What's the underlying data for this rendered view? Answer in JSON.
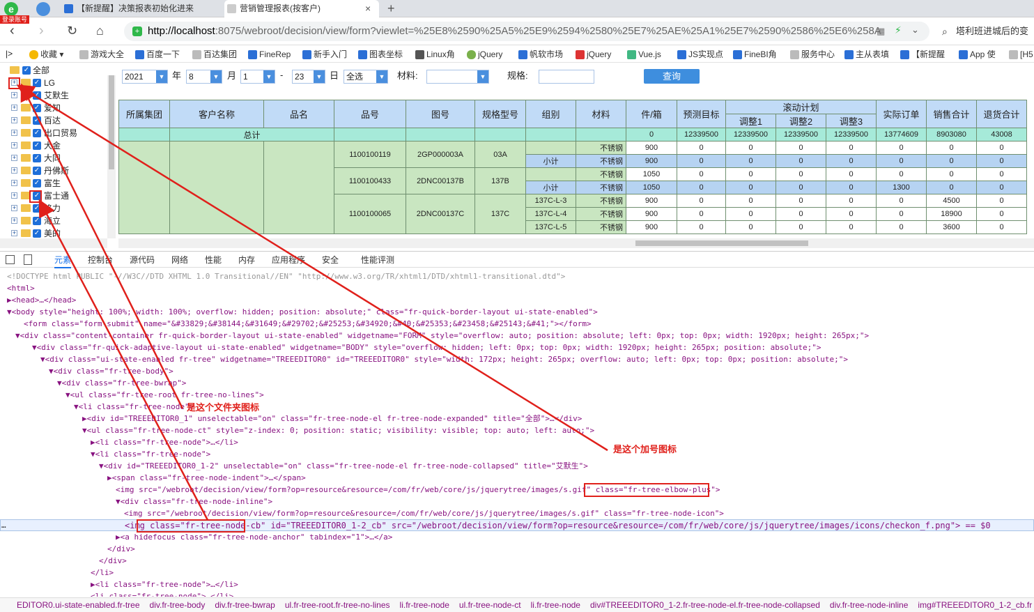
{
  "browser": {
    "tabs": [
      {
        "label": "【新提醒】决策报表初始化进来"
      },
      {
        "label": "营销管理报表(按客户)"
      }
    ],
    "new_tab": "+",
    "close": "×",
    "badge": "登录账号",
    "url_host": "http://localhost",
    "url_rest": ":8075/webroot/decision/view/form?viewlet=%25E8%2590%25A5%25E9%2594%2580%25E7%25AE%25A1%25E7%2590%2586%25E6%258A",
    "search": "塔利班进城后的变",
    "bookmarks": [
      "收藏",
      "游戏大全",
      "百度一下",
      "百达集团",
      "FineRep",
      "新手入门",
      "图表坐标",
      "Linux角",
      "jQuery",
      "帆软市场",
      "jQuery",
      "Vue.js",
      "JS实现点",
      "FineBI角",
      "服务中心",
      "主从表填",
      "【新提醒",
      "App 使",
      "[H5"
    ]
  },
  "tree": {
    "nodes": [
      "全部",
      "LG",
      "艾默生",
      "爱知",
      "百达",
      "出口贸易",
      "大金",
      "大同",
      "丹佛斯",
      "富生",
      "富士通",
      "格力",
      "海立",
      "美的"
    ]
  },
  "toolbar": {
    "year_value": "2021",
    "year_label": "年",
    "month_value": "8",
    "month_label": "月",
    "day_from": "1",
    "dash": "-",
    "day_to": "23",
    "day_label": "日",
    "all_value": "全选",
    "material_label": "材料:",
    "spec_label": "规格:",
    "query_label": "查询"
  },
  "report": {
    "headers": [
      "所属集团",
      "客户名称",
      "品名",
      "品号",
      "图号",
      "规格型号",
      "组别",
      "材料",
      "件/箱",
      "预测目标",
      "滚动计划",
      "实际订单",
      "销售合计",
      "退货合计"
    ],
    "subheaders": [
      "调整1",
      "调整2",
      "调整3"
    ],
    "total_label": "总计",
    "total_values": [
      "0",
      "12339500",
      "12339500",
      "12339500",
      "12339500",
      "13774609",
      "8903080",
      "43008"
    ],
    "groups": [
      {
        "code": "1100100119",
        "drawing": "2GP000003A",
        "spec": "03A"
      },
      {
        "code": "1100100433",
        "drawing": "2DNC00137B",
        "spec": "137B"
      },
      {
        "code": "1100100065",
        "drawing": "2DNC00137C",
        "spec": "137C"
      }
    ],
    "rows": [
      {
        "group": "",
        "material": "不锈钢",
        "qty": "900",
        "v": [
          "0",
          "0",
          "0",
          "0",
          "0",
          "0",
          "0"
        ]
      },
      {
        "group": "小计",
        "material": "不锈钢",
        "qty": "900",
        "v": [
          "0",
          "0",
          "0",
          "0",
          "0",
          "0",
          "0"
        ]
      },
      {
        "group": "",
        "material": "不锈钢",
        "qty": "1050",
        "v": [
          "0",
          "0",
          "0",
          "0",
          "0",
          "0",
          "0"
        ]
      },
      {
        "group": "小计",
        "material": "不锈钢",
        "qty": "1050",
        "v": [
          "0",
          "0",
          "0",
          "0",
          "1300",
          "0",
          "0"
        ]
      },
      {
        "group": "137C-L-3",
        "material": "不锈钢",
        "qty": "900",
        "v": [
          "0",
          "0",
          "0",
          "0",
          "0",
          "4500",
          "0"
        ]
      },
      {
        "group": "137C-L-4",
        "material": "不锈钢",
        "qty": "900",
        "v": [
          "0",
          "0",
          "0",
          "0",
          "0",
          "18900",
          "0"
        ]
      },
      {
        "group": "137C-L-5",
        "material": "不锈钢",
        "qty": "900",
        "v": [
          "0",
          "0",
          "0",
          "0",
          "0",
          "3600",
          "0"
        ]
      }
    ]
  },
  "devtools": {
    "tabs": [
      "元素",
      "控制台",
      "源代码",
      "网络",
      "性能",
      "内存",
      "应用程序",
      "安全",
      "性能评测"
    ],
    "lines": [
      "<!DOCTYPE html PUBLIC \"-//W3C//DTD XHTML 1.0 Transitional//EN\" \"http://www.w3.org/TR/xhtml1/DTD/xhtml1-transitional.dtd\">",
      "<html>",
      "▶<head>…</head>",
      "▼<body style=\"height: 100%; width: 100%; overflow: hidden; position: absolute;\" class=\"fr-quick-border-layout ui-state-enabled\">",
      "<form class=\"form-submit\" name=\"&#33829;&#38144;&#31649;&#29702;&#25253;&#34920;&#40;&#25353;&#23458;&#25143;&#41;\"></form>",
      "▼<div class=\"content-container fr-quick-border-layout ui-state-enabled\" widgetname=\"FORM\" style=\"overflow: auto; position: absolute; left: 0px; top: 0px; width: 1920px; height: 265px;\">",
      "▼<div class=\"fr-quick-adaptive-layout ui-state-enabled\" widgetname=\"BODY\" style=\"overflow: hidden; left: 0px; top: 0px; width: 1920px; height: 265px; position: absolute;\">",
      "▼<div class=\"ui-state-enabled fr-tree\" widgetname=\"TREEEDITOR0\" id=\"TREEEDITOR0\" style=\"width: 172px; height: 265px; overflow: auto; left: 0px; top: 0px; position: absolute;\">",
      "▼<div class=\"fr-tree-body\">",
      "▼<div class=\"fr-tree-bwrap\">",
      "▼<ul class=\"fr-tree-root fr-tree-no-lines\">",
      "▼<li class=\"fr-tree-node\">",
      "▶<div id=\"TREEEDITOR0_1\" unselectable=\"on\" class=\"fr-tree-node-el fr-tree-node-expanded\" title=\"全部\">…</div>",
      "▼<ul class=\"fr-tree-node-ct\" style=\"z-index: 0; position: static; visibility: visible; top: auto; left: auto;\">",
      "▶<li class=\"fr-tree-node\">…</li>",
      "▼<li class=\"fr-tree-node\">",
      "▼<div id=\"TREEEDITOR0_1-2\" unselectable=\"on\" class=\"fr-tree-node-el fr-tree-node-collapsed\" title=\"艾默生\">",
      "▶<span class=\"fr-tree-node-indent\">…</span>",
      "<img src=\"/webroot/decision/view/form?op=resource&resource=/com/fr/web/core/js/jquerytree/images/s.gif\" class=\"fr-tree-elbow-plus\">",
      "▼<div class=\"fr-tree-node-inline\">",
      "<img src=\"/webroot/decision/view/form?op=resource&resource=/com/fr/web/core/js/jquerytree/images/s.gif\" class=\"fr-tree-node-icon\">",
      "<img class=\"fr-tree-node-cb\" id=\"TREEEDITOR0_1-2_cb\" src=\"/webroot/decision/view/form?op=resource&resource=/com/fr/web/core/js/jquerytree/images/icons/checkon_f.png\"> == $0",
      "▶<a hidefocus class=\"fr-tree-node-anchor\" tabindex=\"1\">…</a>",
      "</div>",
      "</div>",
      "</li>",
      "▶<li class=\"fr-tree-node\">…</li>",
      "<li class=\"fr-tree-node\">…</li>"
    ],
    "breadcrumbs": [
      "EDITOR0.ui-state-enabled.fr-tree",
      "div.fr-tree-body",
      "div.fr-tree-bwrap",
      "ul.fr-tree-root.fr-tree-no-lines",
      "li.fr-tree-node",
      "ul.fr-tree-node-ct",
      "li.fr-tree-node",
      "div#TREEEDITOR0_1-2.fr-tree-node-el.fr-tree-node-collapsed",
      "div.fr-tree-node-inline",
      "img#TREEEDITOR0_1-2_cb.fr"
    ]
  },
  "annotations": {
    "folder_icon": "是这个文件夹图标",
    "plus_icon": "是这个加号图标"
  },
  "colors": {
    "accent": "#3e8ede",
    "annotation": "#e0201b",
    "header": "#c1dbf7",
    "total": "#a6ead9"
  }
}
